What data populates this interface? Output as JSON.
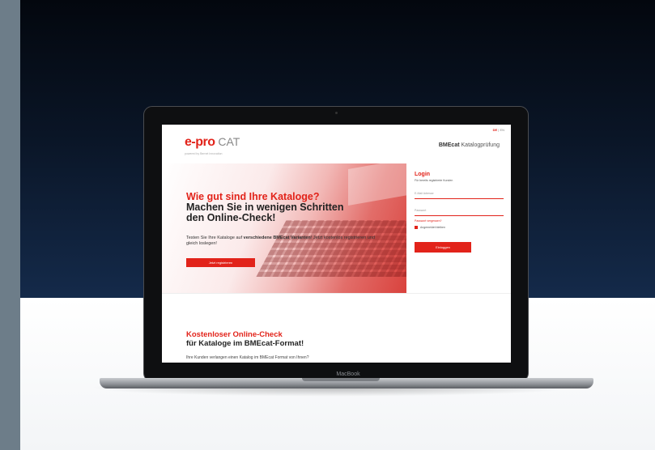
{
  "site": {
    "lang": {
      "de": "DE",
      "sep": " | ",
      "en": "EN"
    },
    "logo": {
      "prefix": "e-pro",
      "suffix": " CAT",
      "tagline": "powered by Bernet Innovation"
    },
    "header_right": {
      "bold": "BMEcat",
      "rest": " Katalogprüfung"
    },
    "hero": {
      "title_red": "Wie gut sind Ihre Kataloge?",
      "title_line2": "Machen Sie in wenigen Schritten",
      "title_line3": "den Online-Check!",
      "text_1": "Testen Sie Ihre Kataloge auf ",
      "text_bold": "verschiedene BMEcat Varianten",
      "text_2": "! Jetzt kostenlos registrieren und gleich loslegen!",
      "register_button": "Jetzt registrieren"
    },
    "login": {
      "title": "Login",
      "subtitle": "Für bereits registrierte Kunden",
      "email_placeholder": "E-Mail Adresse",
      "password_placeholder": "Passwort",
      "forgot": "Passwort vergessen?",
      "remember": "Angemeldet bleiben",
      "button": "Einloggen"
    },
    "section": {
      "title_red": "Kostenloser Online-Check",
      "title_line2": "für Kataloge im BMEcat-Format!",
      "text": "Ihre Kunden verlangen einen Katalog im BMEcat Format von Ihnen?"
    }
  },
  "device": {
    "brand": "MacBook"
  },
  "colors": {
    "accent": "#e2231a",
    "background_dark": "#0a1526",
    "strip": "#6d7d89"
  }
}
